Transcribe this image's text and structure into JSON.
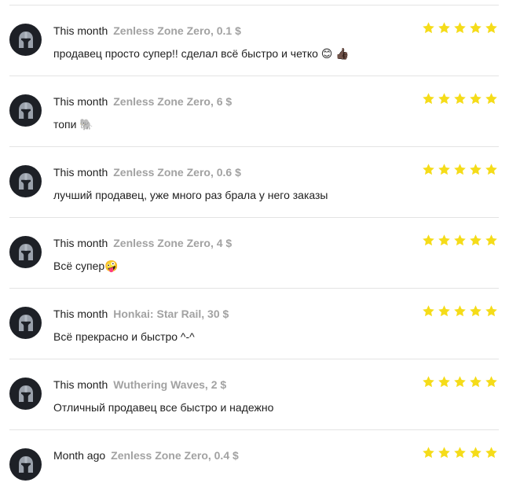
{
  "reviews": [
    {
      "date": "This month",
      "game": "Zenless Zone Zero, 0.1 $",
      "text": "продавец просто супер!! сделал всё быстро и четко 😊 👍🏿",
      "rating": 5
    },
    {
      "date": "This month",
      "game": "Zenless Zone Zero, 6 $",
      "text": "топи 🐘",
      "rating": 5
    },
    {
      "date": "This month",
      "game": "Zenless Zone Zero, 0.6 $",
      "text": "лучший продавец, уже много раз брала у него заказы",
      "rating": 5
    },
    {
      "date": "This month",
      "game": "Zenless Zone Zero, 4 $",
      "text": "Всё супер🤪",
      "rating": 5
    },
    {
      "date": "This month",
      "game": "Honkai: Star Rail, 30 $",
      "text": "Всё прекрасно и быстро ^-^",
      "rating": 5
    },
    {
      "date": "This month",
      "game": "Wuthering Waves, 2 $",
      "text": "Отличный продавец все быстро и надежно",
      "rating": 5
    },
    {
      "date": "Month ago",
      "game": "Zenless Zone Zero, 0.4 $",
      "text": "",
      "rating": 5
    }
  ],
  "colors": {
    "star": "#f5dc19",
    "avatar_bg": "#1d2026",
    "helmet": "#9aa1ab",
    "meta_game": "#a2a2a2",
    "divider": "#e3e3e3"
  },
  "icons": {
    "avatar": "spartan-helmet-icon",
    "rating": "star-icon"
  }
}
